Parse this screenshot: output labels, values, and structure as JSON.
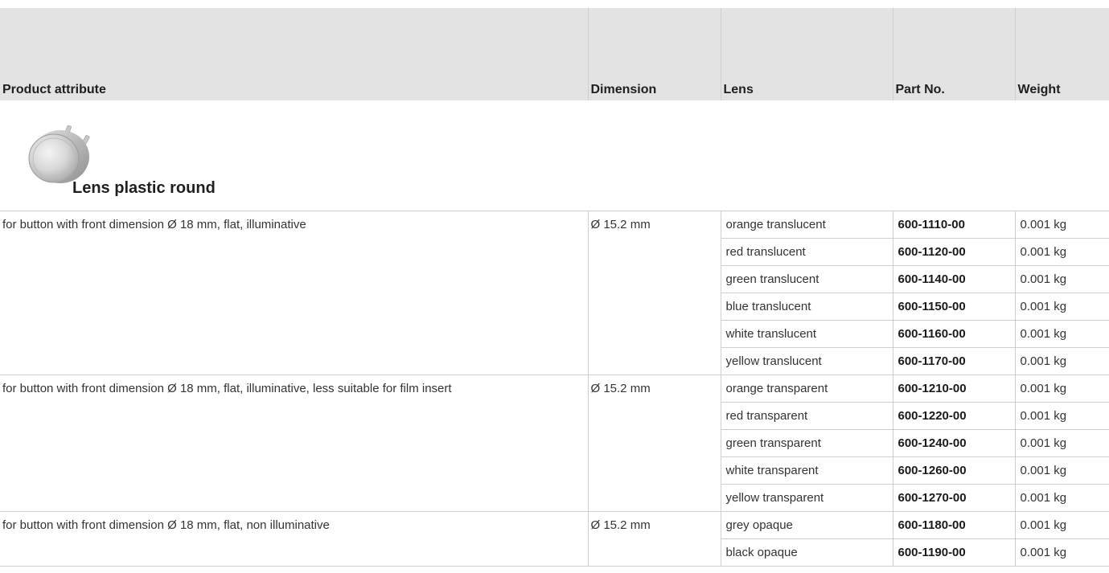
{
  "table": {
    "headers": {
      "attribute": "Product attribute",
      "dimension": "Dimension",
      "lens": "Lens",
      "part_no": "Part No.",
      "weight": "Weight"
    },
    "product_title": "Lens plastic round",
    "groups": [
      {
        "attribute": "for button with front dimension Ø 18 mm, flat, illuminative",
        "dimension": "Ø 15.2 mm",
        "rows": [
          {
            "lens": "orange translucent",
            "part_no": "600-1110-00",
            "weight": "0.001 kg"
          },
          {
            "lens": "red translucent",
            "part_no": "600-1120-00",
            "weight": "0.001 kg"
          },
          {
            "lens": "green translucent",
            "part_no": "600-1140-00",
            "weight": "0.001 kg"
          },
          {
            "lens": "blue translucent",
            "part_no": "600-1150-00",
            "weight": "0.001 kg"
          },
          {
            "lens": "white translucent",
            "part_no": "600-1160-00",
            "weight": "0.001 kg"
          },
          {
            "lens": "yellow translucent",
            "part_no": "600-1170-00",
            "weight": "0.001 kg"
          }
        ]
      },
      {
        "attribute": "for button with front dimension Ø 18 mm, flat, illuminative, less suitable for film insert",
        "dimension": "Ø 15.2 mm",
        "rows": [
          {
            "lens": "orange transparent",
            "part_no": "600-1210-00",
            "weight": "0.001 kg"
          },
          {
            "lens": "red transparent",
            "part_no": "600-1220-00",
            "weight": "0.001 kg"
          },
          {
            "lens": "green transparent",
            "part_no": "600-1240-00",
            "weight": "0.001 kg"
          },
          {
            "lens": "white transparent",
            "part_no": "600-1260-00",
            "weight": "0.001 kg"
          },
          {
            "lens": "yellow transparent",
            "part_no": "600-1270-00",
            "weight": "0.001 kg"
          }
        ]
      },
      {
        "attribute": "for button with front dimension Ø 18 mm, flat, non illuminative",
        "dimension": "Ø 15.2 mm",
        "rows": [
          {
            "lens": "grey opaque",
            "part_no": "600-1180-00",
            "weight": "0.001 kg"
          },
          {
            "lens": "black opaque",
            "part_no": "600-1190-00",
            "weight": "0.001 kg"
          }
        ]
      }
    ]
  },
  "icons": {
    "product_image": "round-plastic-lens-image"
  },
  "colors": {
    "header_background": "#e3e3e3",
    "grid_line": "#cfcfcf",
    "text": "#333333"
  }
}
